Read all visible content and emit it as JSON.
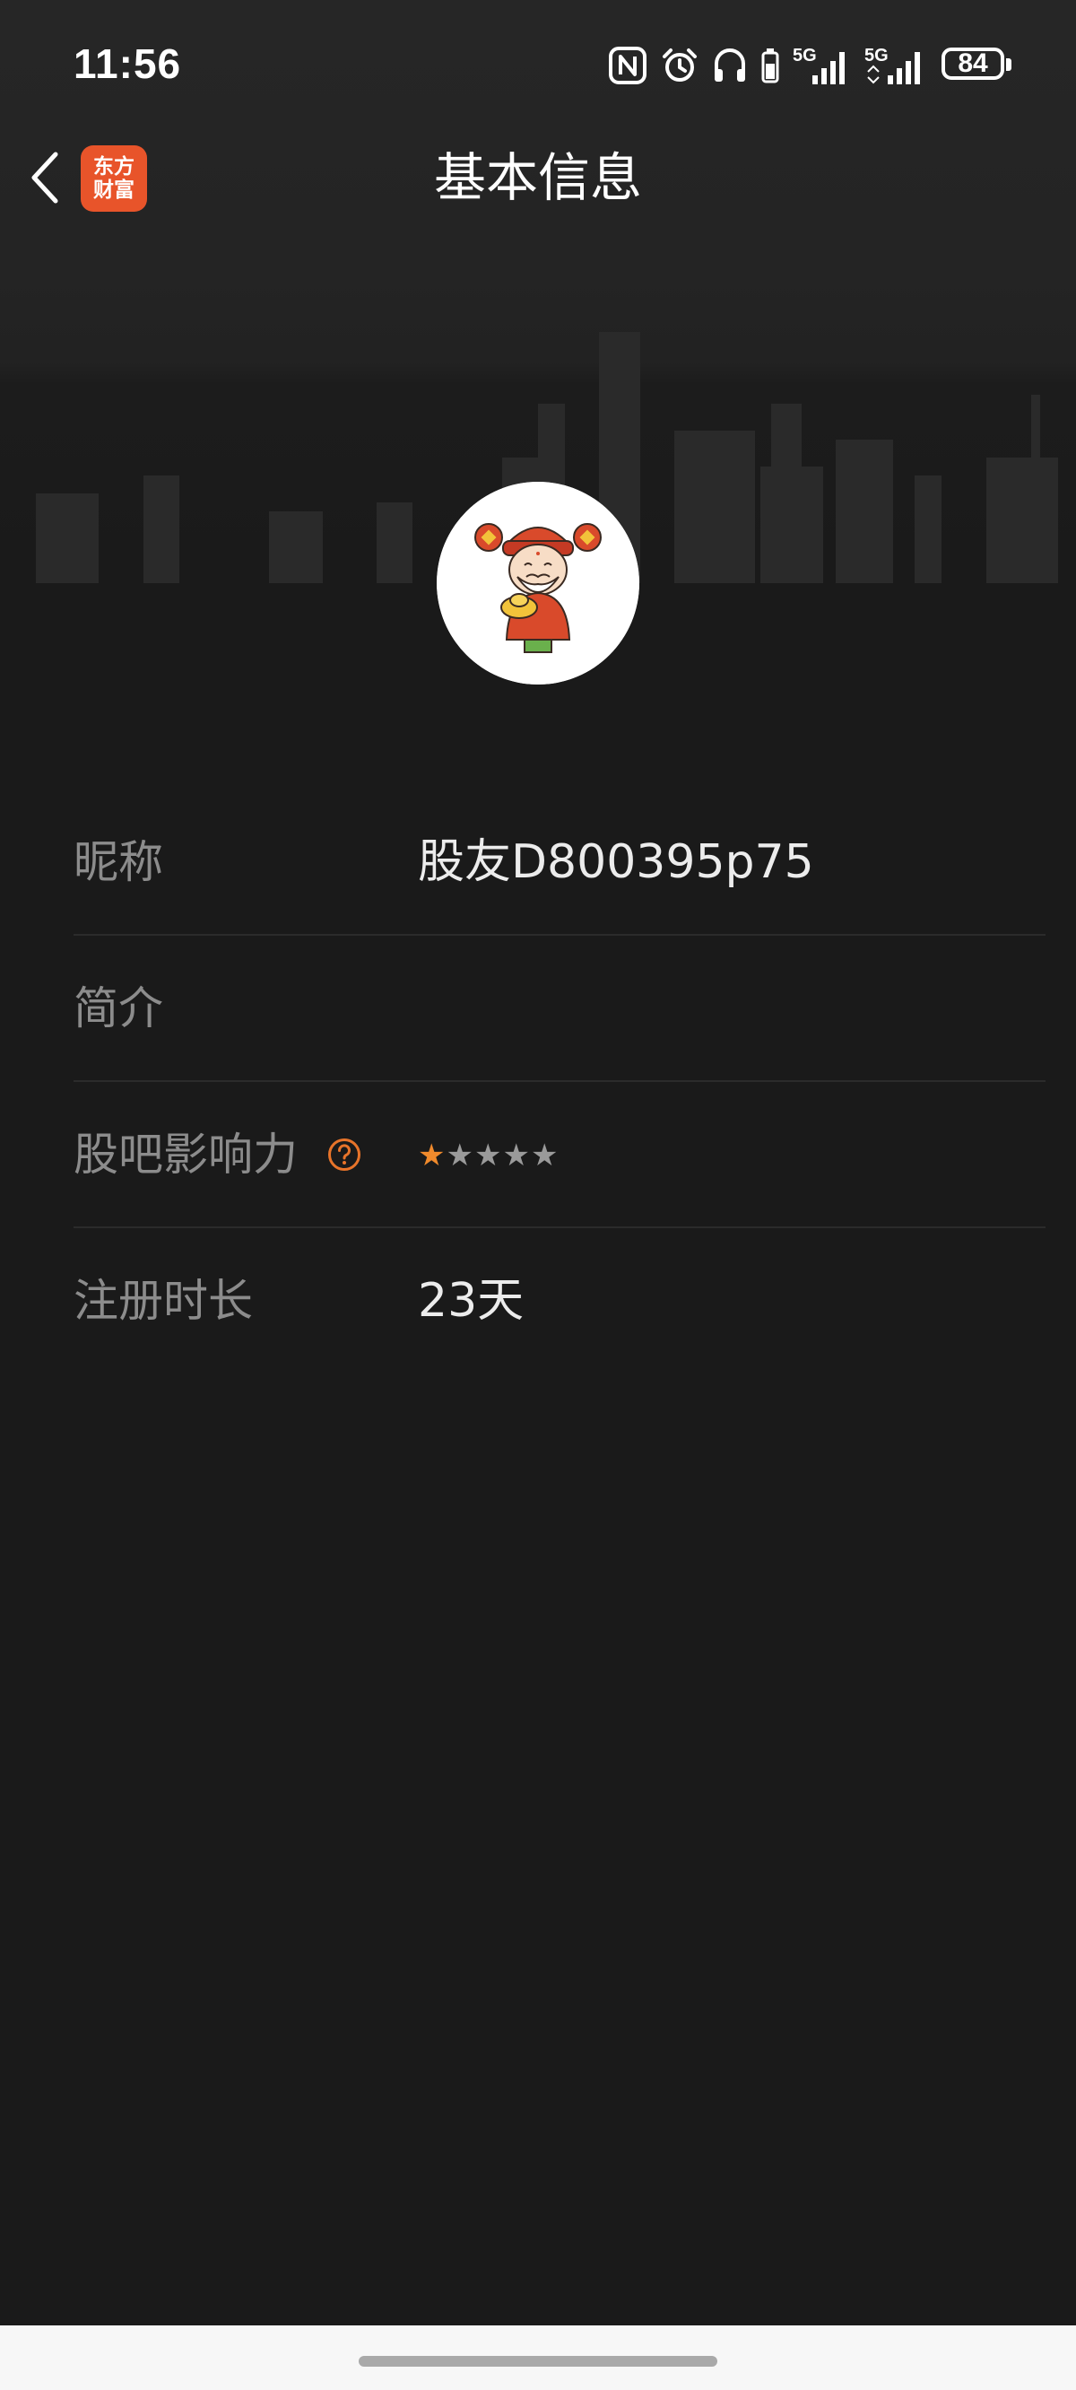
{
  "status_bar": {
    "time": "11:56",
    "network_1": "5G",
    "network_2": "5G",
    "battery": "84",
    "icons": [
      "nfc-icon",
      "alarm-icon",
      "headphones-icon",
      "battery-small-icon",
      "signal-icon",
      "signal-icon"
    ]
  },
  "header": {
    "title": "基本信息",
    "app_badge_line1": "东方",
    "app_badge_line2": "财富",
    "back_icon": "chevron-left-icon"
  },
  "avatar": {
    "icon": "avatar-fortune-god-icon"
  },
  "info": {
    "nickname_label": "昵称",
    "nickname_value": "股友D800395p75",
    "intro_label": "简介",
    "intro_value": "",
    "influence_label": "股吧影响力",
    "influence_stars_filled": 1,
    "influence_stars_total": 5,
    "registration_label": "注册时长",
    "registration_value": "23天"
  },
  "colors": {
    "background": "#1a1a1a",
    "accent_orange": "#e8542a",
    "star_filled": "#f08a2c",
    "star_empty": "#9a9a9a",
    "label_gray": "#8c8c8c"
  }
}
